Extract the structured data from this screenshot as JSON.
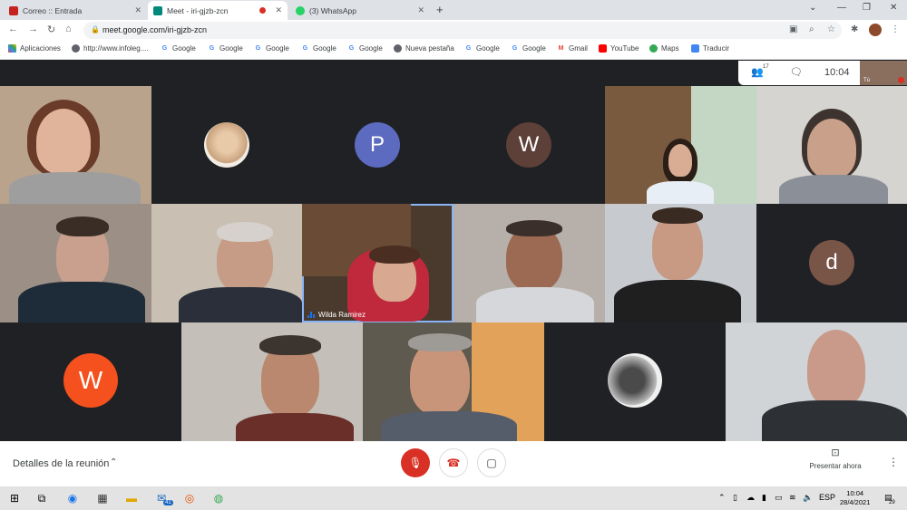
{
  "tabs": [
    {
      "title": "Correo :: Entrada",
      "active": false
    },
    {
      "title": "Meet - iri-gjzb-zcn",
      "active": true
    },
    {
      "title": "(3) WhatsApp",
      "active": false
    }
  ],
  "address_bar": {
    "url": "meet.google.com/iri-gjzb-zcn"
  },
  "bookmarks": [
    "Aplicaciones",
    "http://www.infoleg....",
    "Google",
    "Google",
    "Google",
    "Google",
    "Google",
    "Nueva pestaña",
    "Google",
    "Google",
    "Gmail",
    "YouTube",
    "Maps",
    "Traducir"
  ],
  "meet": {
    "participant_count": "17",
    "clock": "10:04",
    "self_label": "Tú",
    "speaking_name": "Wilda Ramirez",
    "avatar_letters": [
      "P",
      "W",
      "d",
      "W"
    ]
  },
  "bottom_bar": {
    "meeting_details": "Detalles de la reunión",
    "present_now": "Presentar ahora"
  },
  "taskbar": {
    "mail_badge": "41",
    "language": "ESP",
    "time": "10:04",
    "date": "28/4/2021",
    "notification_count": "29"
  },
  "colors": {
    "meet_bg": "#202124",
    "avatar_p": "#5c6bc0",
    "avatar_w_brown": "#5d4037",
    "avatar_d": "#795548",
    "avatar_w_orange": "#f4511e",
    "mic_off": "#d93025"
  }
}
